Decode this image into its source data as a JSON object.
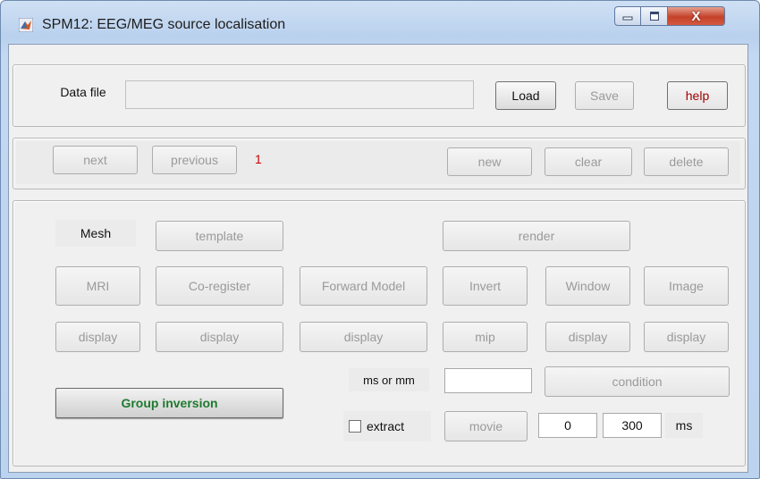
{
  "window": {
    "title": "SPM12: EEG/MEG source localisation",
    "controls": [
      "minimize-icon",
      "maximize-icon",
      "close-icon"
    ],
    "close_glyph": "X"
  },
  "file_panel": {
    "data_file_label": "Data file",
    "data_file_value": "",
    "load_label": "Load",
    "save_label": "Save",
    "help_label": "help"
  },
  "nav_panel": {
    "next_label": "next",
    "previous_label": "previous",
    "counter": "1",
    "new_label": "new",
    "clear_label": "clear",
    "delete_label": "delete"
  },
  "main_panel": {
    "mesh_label": "Mesh",
    "template_label": "template",
    "render_label": "render",
    "mri_label": "MRI",
    "coregister_label": "Co-register",
    "forward_model_label": "Forward Model",
    "invert_label": "Invert",
    "window_label": "Window",
    "image_label": "Image",
    "display_mri_label": "display",
    "display_coregister_label": "display",
    "display_forward_label": "display",
    "mip_label": "mip",
    "display_window_label": "display",
    "display_image_label": "display",
    "ms_or_mm_label": "ms or mm",
    "ms_or_mm_value": "",
    "condition_label": "condition",
    "group_inversion_label": "Group inversion",
    "extract_label": "extract",
    "extract_checked": false,
    "movie_label": "movie",
    "movie_start": "0",
    "movie_end": "300",
    "ms_unit_label": "ms"
  },
  "colors": {
    "group_inversion_text": "#1e7a2e",
    "help_text": "#a00000",
    "counter_text": "#cc0000",
    "disabled_text": "#9a9a9a"
  }
}
